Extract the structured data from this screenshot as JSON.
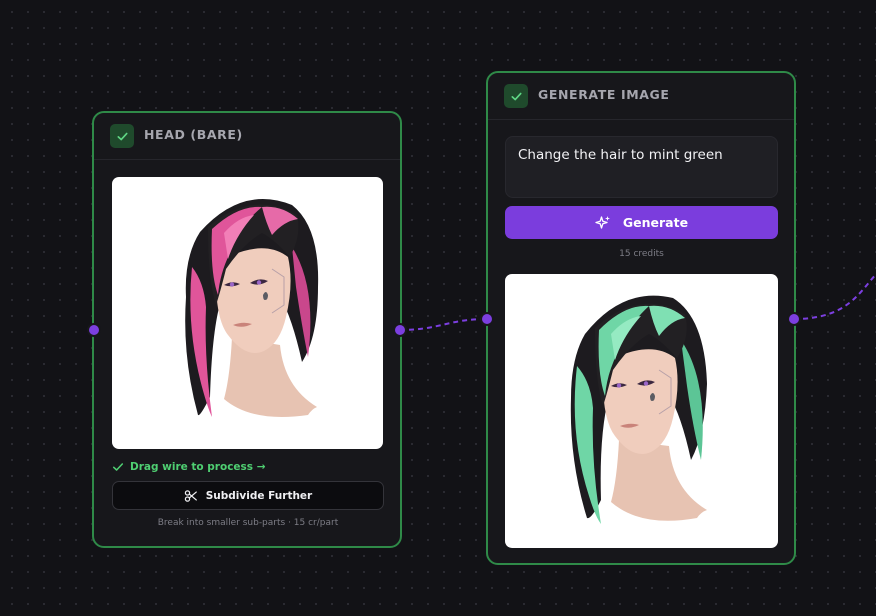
{
  "nodes": {
    "head": {
      "title": "HEAD (BARE)",
      "status_text": "Drag wire to process →",
      "subdivide_label": "Subdivide Further",
      "subdivide_caption": "Break into smaller sub-parts · 15 cr/part",
      "image_alt": "3D head with pink and black hair"
    },
    "generate": {
      "title": "GENERATE IMAGE",
      "prompt_value": "Change the hair to mint green",
      "generate_label": "Generate",
      "credits_text": "15 credits",
      "image_alt": "3D head with mint green and black hair"
    }
  },
  "colors": {
    "node_border": "#2f8a48",
    "accent": "#7b3ddd",
    "status_green": "#4fcf72",
    "pink_hair": "#e0559a",
    "mint_hair": "#6fd6a6"
  },
  "icons": {
    "checkbox": "check-icon",
    "status": "check-icon",
    "subdivide": "scissors-icon",
    "generate": "sparkles-icon"
  }
}
